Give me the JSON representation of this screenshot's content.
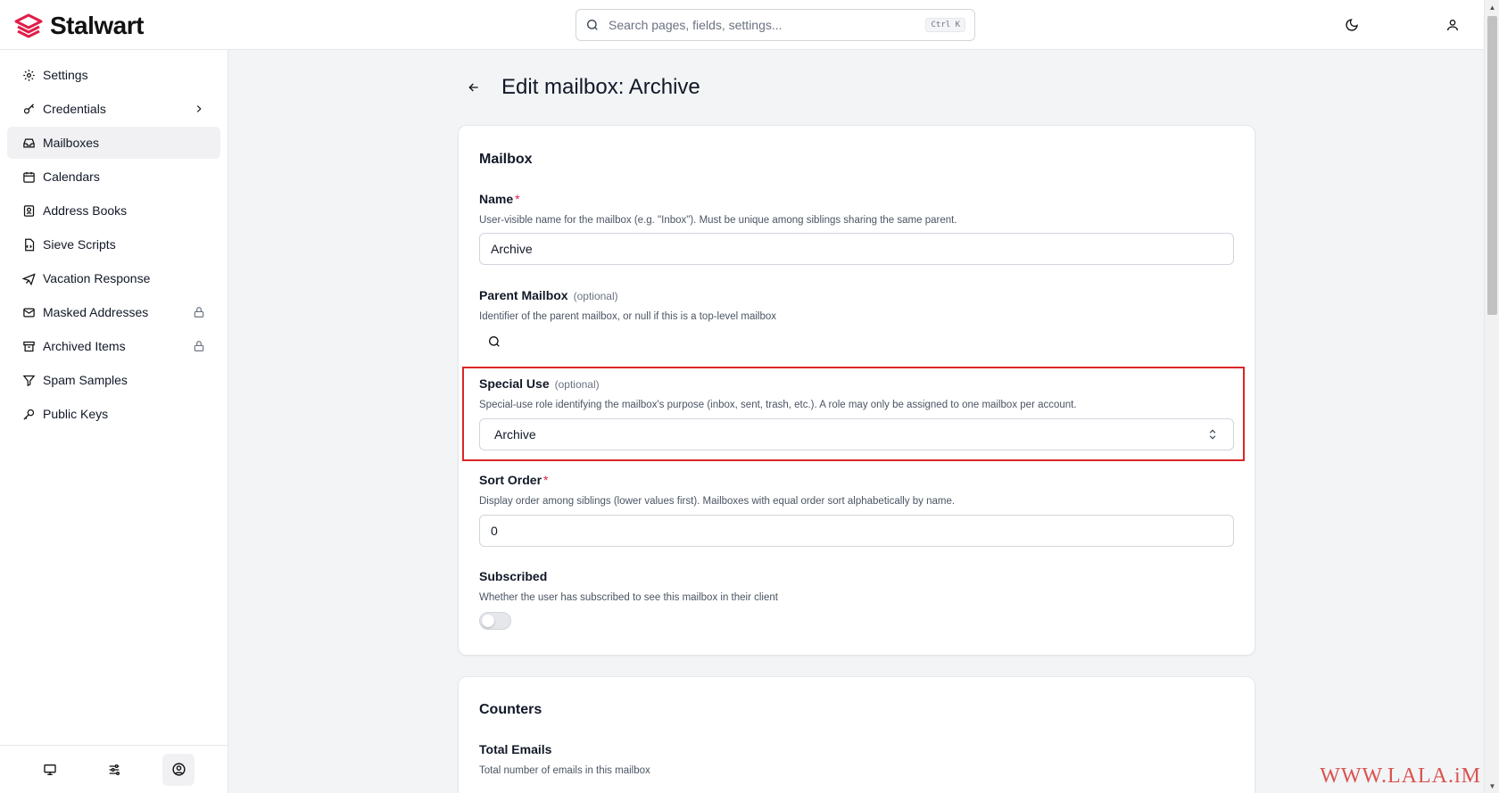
{
  "app": {
    "name": "Stalwart",
    "brand_color": "#e11d48"
  },
  "search": {
    "placeholder": "Search pages, fields, settings...",
    "shortcut": "Ctrl K"
  },
  "sidebar": {
    "items": [
      {
        "label": "Settings",
        "icon": "gear-icon"
      },
      {
        "label": "Credentials",
        "icon": "key-icon",
        "chevron": true
      },
      {
        "label": "Mailboxes",
        "icon": "inbox-icon",
        "active": true
      },
      {
        "label": "Calendars",
        "icon": "calendar-icon"
      },
      {
        "label": "Address Books",
        "icon": "contact-book-icon"
      },
      {
        "label": "Sieve Scripts",
        "icon": "script-file-icon"
      },
      {
        "label": "Vacation Response",
        "icon": "plane-icon"
      },
      {
        "label": "Masked Addresses",
        "icon": "mail-icon",
        "locked": true
      },
      {
        "label": "Archived Items",
        "icon": "archive-box-icon",
        "locked": true
      },
      {
        "label": "Spam Samples",
        "icon": "filter-icon"
      },
      {
        "label": "Public Keys",
        "icon": "key-icon"
      }
    ],
    "footer": [
      "monitor-icon",
      "sliders-icon",
      "user-circle-icon"
    ]
  },
  "page": {
    "title": "Edit mailbox: Archive"
  },
  "mailbox_card": {
    "title": "Mailbox",
    "name": {
      "label": "Name",
      "required": "*",
      "description": "User-visible name for the mailbox (e.g. \"Inbox\"). Must be unique among siblings sharing the same parent.",
      "value": "Archive"
    },
    "parent": {
      "label": "Parent Mailbox",
      "optional": "(optional)",
      "description": "Identifier of the parent mailbox, or null if this is a top-level mailbox"
    },
    "special_use": {
      "label": "Special Use",
      "optional": "(optional)",
      "description": "Special-use role identifying the mailbox's purpose (inbox, sent, trash, etc.). A role may only be assigned to one mailbox per account.",
      "value": "Archive"
    },
    "sort_order": {
      "label": "Sort Order",
      "required": "*",
      "description": "Display order among siblings (lower values first). Mailboxes with equal order sort alphabetically by name.",
      "value": "0"
    },
    "subscribed": {
      "label": "Subscribed",
      "description": "Whether the user has subscribed to see this mailbox in their client",
      "checked": false
    }
  },
  "counters_card": {
    "title": "Counters",
    "total_emails": {
      "label": "Total Emails",
      "description": "Total number of emails in this mailbox"
    }
  },
  "watermark": "WWW.LALA.iM"
}
